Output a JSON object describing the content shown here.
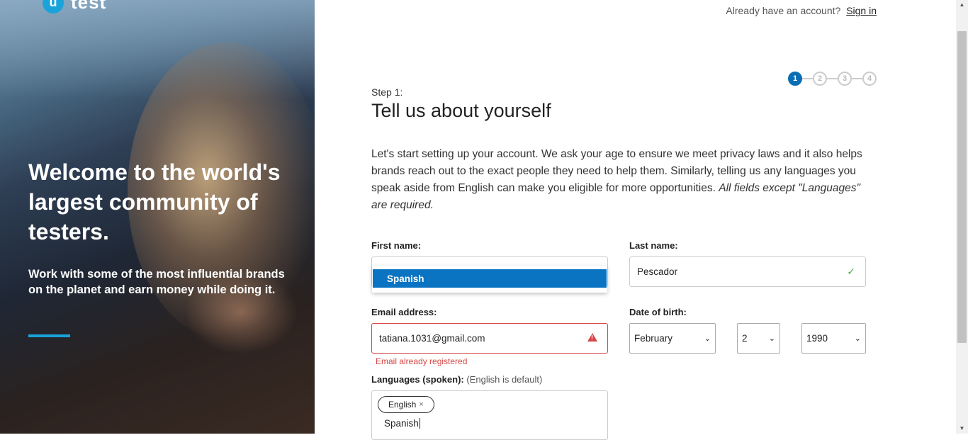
{
  "brand": {
    "logo_letter": "u",
    "logo_text": "test"
  },
  "hero": {
    "title": "Welcome to the world's largest community of testers.",
    "subtitle": "Work with some of the most influential brands on the planet and earn money while doing it."
  },
  "header": {
    "account_prompt": "Already have an account?",
    "signin_link": "Sign in"
  },
  "steps": [
    "1",
    "2",
    "3",
    "4"
  ],
  "form": {
    "step_label": "Step 1:",
    "title": "Tell us about yourself",
    "intro": "Let's start setting up your account. We ask your age to ensure we meet privacy laws and it also helps brands reach out to the exact people they need to help them. Similarly, telling us any languages you speak aside from English can make you eligible for more opportunities.",
    "intro_emphasis": "All fields except \"Languages\" are required.",
    "first_name_label": "First name:",
    "last_name_label": "Last name:",
    "last_name_value": "Pescador",
    "email_label": "Email address:",
    "email_value": "tatiana.1031@gmail.com",
    "email_error": "Email already registered",
    "dob_label": "Date of birth:",
    "dob_month": "February",
    "dob_day": "2",
    "dob_year": "1990",
    "languages_label": "Languages (spoken):",
    "languages_hint": "(English is default)",
    "languages_tag": "English",
    "languages_tag_remove": "×",
    "languages_typed": "Spanish",
    "dropdown_option": "Spanish"
  },
  "colors": {
    "accent": "#0a6eb4",
    "error": "#d64545",
    "success": "#4caf50",
    "hero_bar": "#1aa3d9"
  }
}
